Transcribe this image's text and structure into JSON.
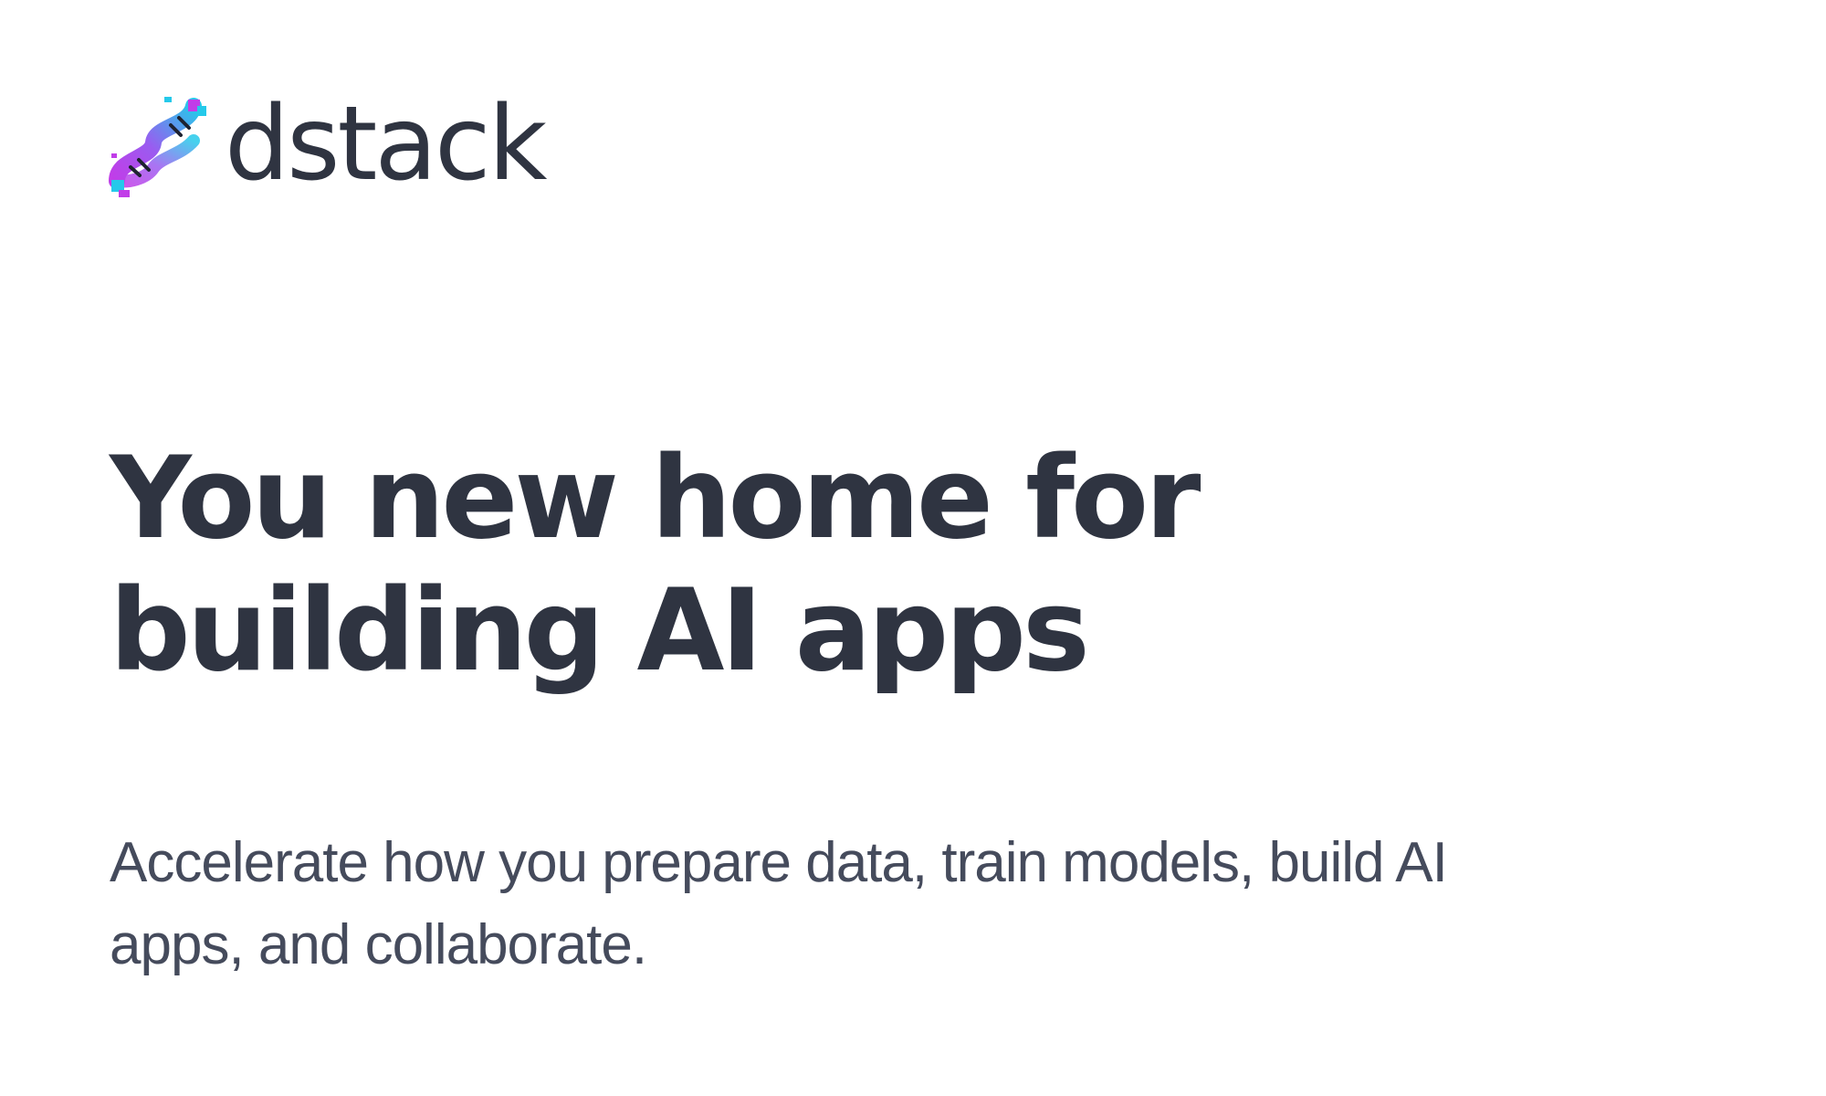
{
  "brand": {
    "name": "dstack",
    "logo_icon": "dna-helix-icon",
    "gradient_start": "#c13de8",
    "gradient_end": "#25c9ea"
  },
  "hero": {
    "title_line_1": "You new home for",
    "title_line_2": "building AI apps",
    "subtitle_line_1": "Accelerate how you prepare data, train models, build AI",
    "subtitle_line_2": "apps, and collaborate."
  }
}
